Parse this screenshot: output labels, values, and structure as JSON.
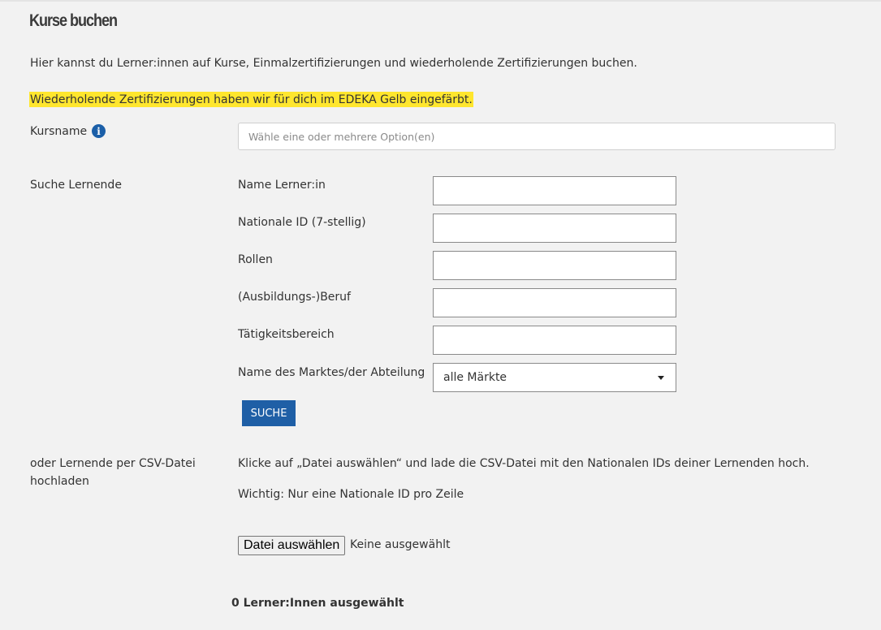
{
  "page": {
    "title": "Kurse buchen",
    "intro": "Hier kannst du Lerner:innen auf Kurse, Einmalzertifizierungen und wiederholende Zertifizierungen buchen.",
    "highlight": "Wiederholende Zertifizierungen haben wir für dich im EDEKA Gelb eingefärbt."
  },
  "kursname": {
    "label": "Kursname",
    "info_icon": "info-icon",
    "placeholder": "Wähle eine oder mehrere Option(en)"
  },
  "search": {
    "section_label": "Suche Lernende",
    "fields": [
      {
        "label": "Name Lerner:in",
        "value": ""
      },
      {
        "label": "Nationale ID (7-stellig)",
        "value": ""
      },
      {
        "label": "Rollen",
        "value": ""
      },
      {
        "label": "(Ausbildungs-)Beruf",
        "value": ""
      },
      {
        "label": "Tätigkeitsbereich",
        "value": ""
      }
    ],
    "market": {
      "label": "Name des Marktes/der Abteilung",
      "selected": "alle Märkte"
    },
    "button_label": "SUCHE"
  },
  "csv": {
    "section_label_line1": "oder Lernende per CSV-Datei",
    "section_label_line2": "hochladen",
    "instruction": "Klicke auf „Datei auswählen“ und lade die CSV-Datei mit den Nationalen IDs deiner Lernenden hoch.",
    "note": "Wichtig: Nur eine Nationale ID pro Zeile",
    "file_button": "Datei auswählen",
    "file_status": "Keine ausgewählt"
  },
  "summary": {
    "selected_count": "0 Lerner:Innen ausgewählt"
  },
  "colors": {
    "highlight": "#ffe62e",
    "primary_button": "#1f5fa6",
    "info_icon": "#1b5fa8"
  }
}
